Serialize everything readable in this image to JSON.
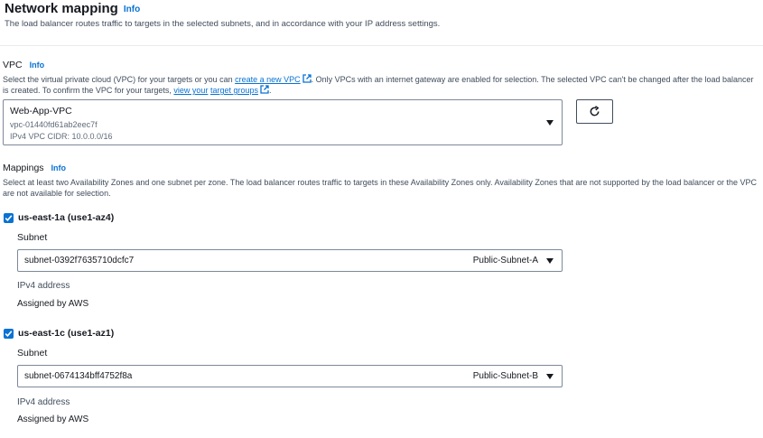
{
  "header": {
    "title": "Network mapping",
    "info": "Info",
    "description": "The load balancer routes traffic to targets in the selected subnets, and in accordance with your IP address settings."
  },
  "vpc": {
    "label": "VPC",
    "info": "Info",
    "desc_part1": "Select the virtual private cloud (VPC) for your targets or you can ",
    "create_link": "create a new VPC",
    "desc_part2": ". Only VPCs with an internet gateway are enabled for selection. The selected VPC can't be changed after the load balancer is created. To confirm the VPC for your targets, ",
    "view_link_prefix": "view your",
    "target_groups_link": "target groups",
    "desc_part3": ".",
    "selected": {
      "name": "Web-App-VPC",
      "id": "vpc-01440fd61ab2eec7f",
      "cidr": "IPv4 VPC CIDR: 10.0.0.0/16"
    },
    "refresh_icon": "refresh-icon"
  },
  "mappings": {
    "label": "Mappings",
    "info": "Info",
    "description": "Select at least two Availability Zones and one subnet per zone. The load balancer routes traffic to targets in these Availability Zones only. Availability Zones that are not supported by the load balancer or the VPC are not available for selection.",
    "zones": [
      {
        "name": "us-east-1a (use1-az4)",
        "checked": true,
        "subnet_label": "Subnet",
        "subnet_id": "subnet-0392f7635710dcfc7",
        "subnet_name": "Public-Subnet-A",
        "ipv4_label": "IPv4 address",
        "ipv4_value": "Assigned by AWS"
      },
      {
        "name": "us-east-1c (use1-az1)",
        "checked": true,
        "subnet_label": "Subnet",
        "subnet_id": "subnet-0674134bff4752f8a",
        "subnet_name": "Public-Subnet-B",
        "ipv4_label": "IPv4 address",
        "ipv4_value": "Assigned by AWS"
      }
    ]
  },
  "colors": {
    "link": "#0972d3",
    "text": "#16191f",
    "secondary_text": "#414d5c",
    "border": "#7d8998"
  }
}
